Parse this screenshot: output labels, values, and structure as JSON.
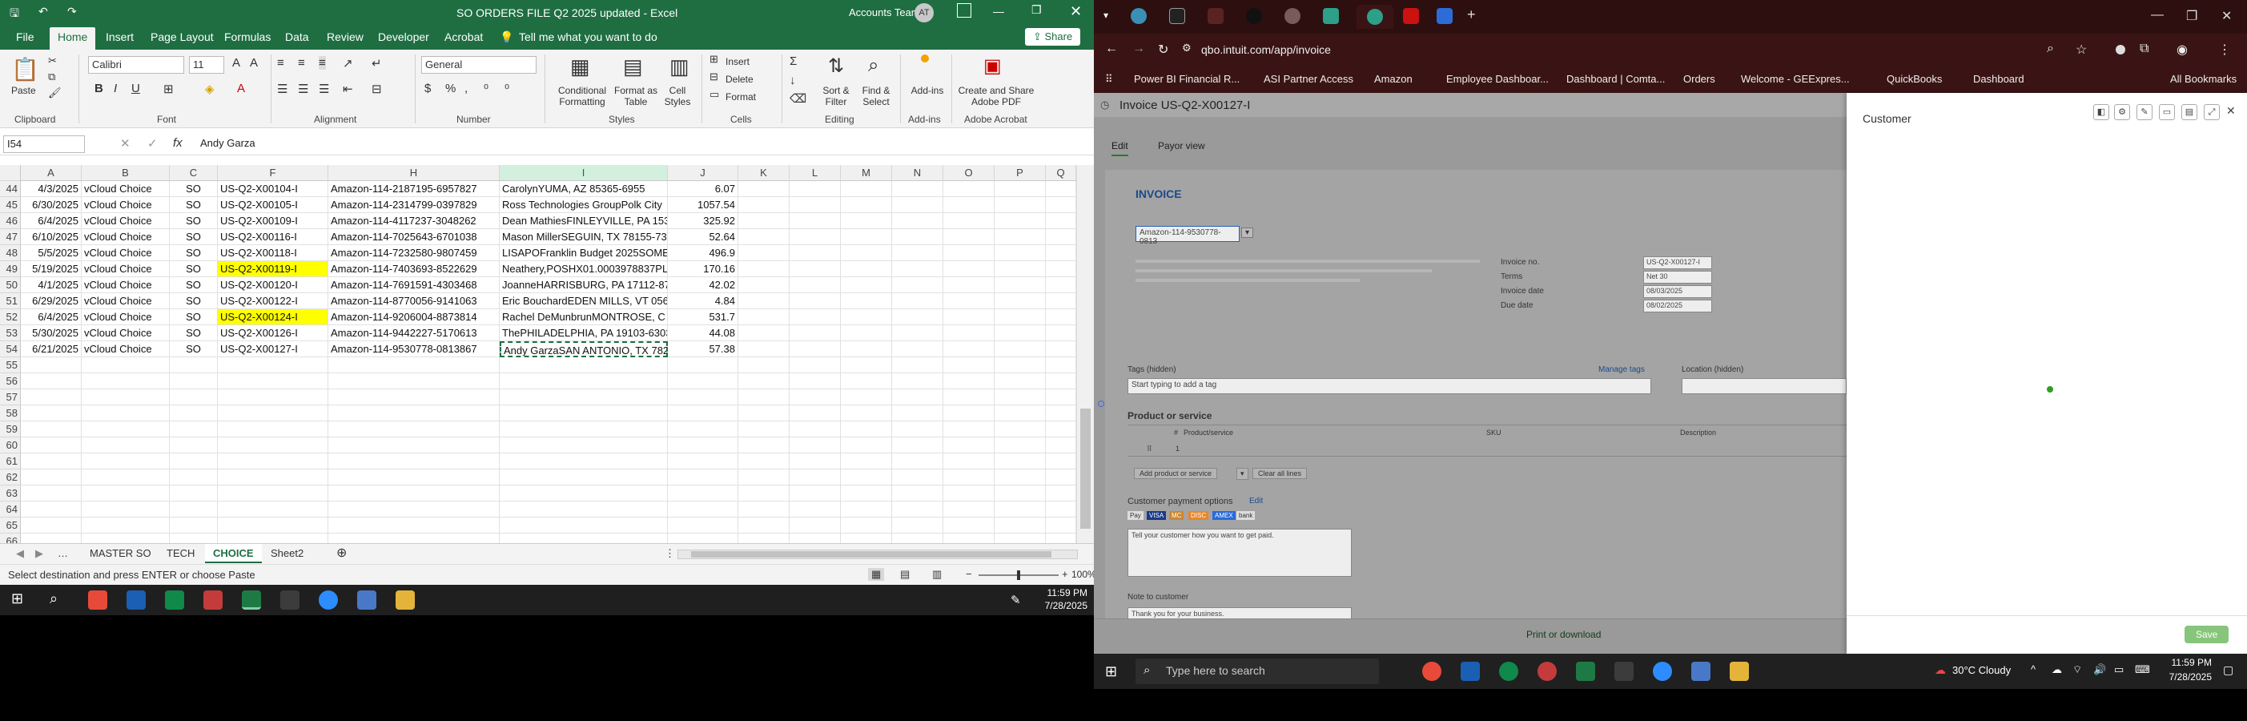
{
  "excel": {
    "title": "SO ORDERS FILE Q2 2025 updated  -  Excel",
    "account": "Accounts Team",
    "avatar": "AT",
    "share": "Share",
    "menu": [
      "File",
      "Home",
      "Insert",
      "Page Layout",
      "Formulas",
      "Data",
      "Review",
      "Developer",
      "Acrobat"
    ],
    "tellme": "Tell me what you want to do",
    "font_name": "Calibri",
    "font_size": "11",
    "number_format": "General",
    "ribbon_buttons": {
      "paste": "Paste",
      "cond": "Conditional Formatting",
      "format_table": "Format as Table",
      "cell_styles": "Cell Styles",
      "insert": "Insert",
      "delete": "Delete",
      "format": "Format",
      "sort": "Sort & Filter",
      "find": "Find & Select",
      "addins": "Add-ins",
      "adobe": "Create and Share Adobe PDF",
      "autosum": "Σ"
    },
    "groups": [
      "Clipboard",
      "Font",
      "Alignment",
      "Number",
      "Styles",
      "Cells",
      "Editing",
      "Add-ins",
      "Adobe Acrobat"
    ],
    "name_box": "I54",
    "formula": "Andy Garza",
    "columns": [
      "A",
      "B",
      "C",
      "F",
      "H",
      "I",
      "J",
      "K",
      "L",
      "M",
      "N",
      "O",
      "P",
      "Q"
    ],
    "rows": [
      {
        "n": "44",
        "a": "4/3/2025",
        "b": "vCloud Choice",
        "c": "SO",
        "f": "US-Q2-X00104-I",
        "h": "Amazon-114-2187195-6957827",
        "i": "CarolynYUMA, AZ 85365-6955",
        "j": "6.07",
        "hl": false
      },
      {
        "n": "45",
        "a": "6/30/2025",
        "b": "vCloud Choice",
        "c": "SO",
        "f": "US-Q2-X00105-I",
        "h": "Amazon-114-2314799-0397829",
        "i": "Ross Technologies GroupPolk City",
        "j": "1057.54",
        "hl": false
      },
      {
        "n": "46",
        "a": "6/4/2025",
        "b": "vCloud Choice",
        "c": "SO",
        "f": "US-Q2-X00109-I",
        "h": "Amazon-114-4117237-3048262",
        "i": "Dean MathiesFINLEYVILLE, PA 153",
        "j": "325.92",
        "hl": false
      },
      {
        "n": "47",
        "a": "6/10/2025",
        "b": "vCloud Choice",
        "c": "SO",
        "f": "US-Q2-X00116-I",
        "h": "Amazon-114-7025643-6701038",
        "i": "Mason MillerSEGUIN, TX 78155-73",
        "j": "52.64",
        "hl": false
      },
      {
        "n": "48",
        "a": "5/5/2025",
        "b": "vCloud Choice",
        "c": "SO",
        "f": "US-Q2-X00118-I",
        "h": "Amazon-114-7232580-9807459",
        "i": "LISAPOFranklin Budget 2025SOME",
        "j": "496.9",
        "hl": false
      },
      {
        "n": "49",
        "a": "5/19/2025",
        "b": "vCloud Choice",
        "c": "SO",
        "f": "US-Q2-X00119-I",
        "h": "Amazon-114-7403693-8522629",
        "i": "Neathery,POSHX01.0003978837PL",
        "j": "170.16",
        "hl": true
      },
      {
        "n": "50",
        "a": "4/1/2025",
        "b": "vCloud Choice",
        "c": "SO",
        "f": "US-Q2-X00120-I",
        "h": "Amazon-114-7691591-4303468",
        "i": "JoanneHARRISBURG, PA 17112-87",
        "j": "42.02",
        "hl": false
      },
      {
        "n": "51",
        "a": "6/29/2025",
        "b": "vCloud Choice",
        "c": "SO",
        "f": "US-Q2-X00122-I",
        "h": "Amazon-114-8770056-9141063",
        "i": "Eric BouchardEDEN MILLS, VT 056",
        "j": "4.84",
        "hl": false
      },
      {
        "n": "52",
        "a": "6/4/2025",
        "b": "vCloud Choice",
        "c": "SO",
        "f": "US-Q2-X00124-I",
        "h": "Amazon-114-9206004-8873814",
        "i": "Rachel DeMunbrunMONTROSE, C",
        "j": "531.7",
        "hl": true
      },
      {
        "n": "53",
        "a": "5/30/2025",
        "b": "vCloud Choice",
        "c": "SO",
        "f": "US-Q2-X00126-I",
        "h": "Amazon-114-9442227-5170613",
        "i": "ThePHILADELPHIA, PA 19103-6303",
        "j": "44.08",
        "hl": false
      },
      {
        "n": "54",
        "a": "6/21/2025",
        "b": "vCloud Choice",
        "c": "SO",
        "f": "US-Q2-X00127-I",
        "h": "Amazon-114-9530778-0813867",
        "i": "Andy GarzaSAN ANTONIO, TX 782",
        "j": "57.38",
        "hl": false
      }
    ],
    "empty_rows": [
      "55",
      "56",
      "57",
      "58",
      "59",
      "60",
      "61",
      "62",
      "63",
      "64",
      "65",
      "66"
    ],
    "sheets": [
      "MASTER SO",
      "TECH",
      "CHOICE",
      "Sheet2"
    ],
    "active_sheet": "CHOICE",
    "status": "Select destination and press ENTER or choose Paste",
    "zoom": "100%",
    "clock_time": "11:59 PM",
    "clock_date": "7/28/2025"
  },
  "browser": {
    "url": "qbo.intuit.com/app/invoice",
    "bookmarks": [
      "Power BI Financial R...",
      "ASI Partner Access",
      "Amazon",
      "Employee Dashboar...",
      "Dashboard | Comta...",
      "Orders",
      "Welcome - GEExpres...",
      "QuickBooks",
      "Dashboard"
    ],
    "all_bookmarks": "All Bookmarks",
    "invoice_title": "Invoice US-Q2-X00127-I",
    "tabs": [
      "Edit",
      "Payor view"
    ],
    "invoice_label": "INVOICE",
    "customer_select": "Amazon-114-9530778-0813",
    "fields": [
      {
        "label": "Invoice no.",
        "value": "US-Q2-X00127-I"
      },
      {
        "label": "Terms",
        "value": "Net 30"
      },
      {
        "label": "Invoice date",
        "value": "08/03/2025"
      },
      {
        "label": "Due date",
        "value": "08/02/2025"
      }
    ],
    "tags_label": "Tags (hidden)",
    "manage_tags": "Manage tags",
    "tags_placeholder": "Start typing to add a tag",
    "location_label": "Location (hidden)",
    "product_heading": "Product or service",
    "table_headers": [
      "#",
      "Product/service",
      "SKU",
      "Description"
    ],
    "line_no": "1",
    "add_line": "Add product or service",
    "clear_lines": "Clear all lines",
    "payment_heading": "Customer payment options",
    "payment_edit": "Edit",
    "payment_methods": [
      "Pay",
      "VISA",
      "MC",
      "DISC",
      "AMEX",
      "bank"
    ],
    "payment_note": "Tell your customer how you want to get paid.",
    "note_heading": "Note to customer",
    "note_text": "Thank you for your business.",
    "print_download": "Print or download",
    "panel_title": "Customer",
    "save": "Save",
    "search_placeholder": "Type here to search",
    "weather": "30°C  Cloudy",
    "clock_time": "11:59 PM",
    "clock_date": "7/28/2025"
  }
}
